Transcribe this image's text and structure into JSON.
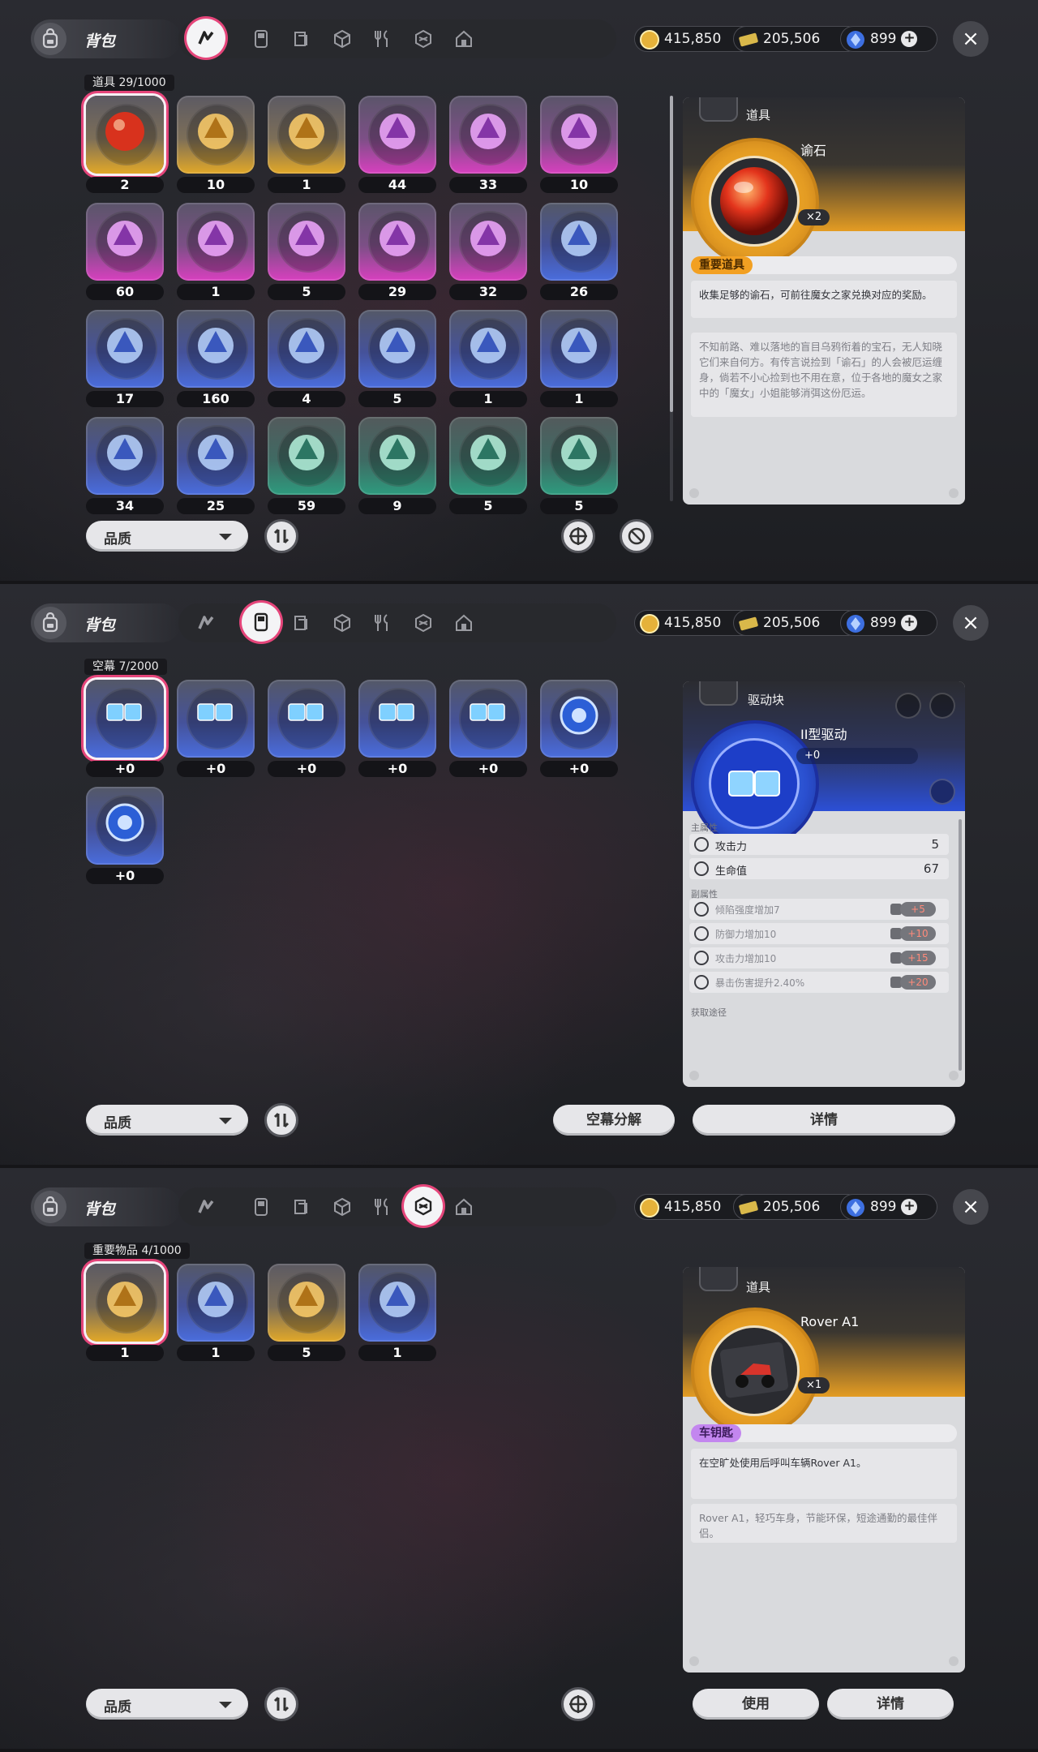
{
  "colors": {
    "accent": "#e5457a",
    "gold": "#e49c23",
    "purple": "#d840bf",
    "blue": "#4a6ddd",
    "green": "#2e9b7e"
  },
  "shared": {
    "bag_title": "背包",
    "currency": [
      {
        "icon": "gold-coin-icon",
        "value": "415,850"
      },
      {
        "icon": "ticket-icon",
        "value": "205,506"
      },
      {
        "icon": "crystal-icon",
        "value": "899"
      }
    ],
    "plus_label": "+",
    "close_label": "×",
    "quality_label": "品质"
  },
  "panels": {
    "items": {
      "active_tab": "tab-props",
      "count_label": "道具 29/1000",
      "grid": [
        {
          "q": "gold",
          "qty": "2",
          "icon": "red-orb-icon"
        },
        {
          "q": "gold",
          "qty": "10",
          "icon": "chess-knight-icon"
        },
        {
          "q": "gold",
          "qty": "1",
          "icon": "belt-icon"
        },
        {
          "q": "purple",
          "qty": "44",
          "icon": "cards-icon"
        },
        {
          "q": "purple",
          "qty": "33",
          "icon": "game-cartridge-icon"
        },
        {
          "q": "purple",
          "qty": "10",
          "icon": "crystal-cluster-icon"
        },
        {
          "q": "purple",
          "qty": "60",
          "icon": "ice-crystal-icon"
        },
        {
          "q": "purple",
          "qty": "1",
          "icon": "bottle-icon"
        },
        {
          "q": "purple",
          "qty": "5",
          "icon": "conch-icon"
        },
        {
          "q": "purple",
          "qty": "29",
          "icon": "sparkle-crystal-icon"
        },
        {
          "q": "purple",
          "qty": "32",
          "icon": "bunny-badge-icon"
        },
        {
          "q": "blue",
          "qty": "26",
          "icon": "document-icon"
        },
        {
          "q": "blue",
          "qty": "17",
          "icon": "mist-ring-icon"
        },
        {
          "q": "blue",
          "qty": "160",
          "icon": "coin-icon"
        },
        {
          "q": "blue",
          "qty": "4",
          "icon": "orb-pouch-icon"
        },
        {
          "q": "blue",
          "qty": "5",
          "icon": "snack-bag-icon"
        },
        {
          "q": "blue",
          "qty": "1",
          "icon": "paper-bag-icon"
        },
        {
          "q": "blue",
          "qty": "1",
          "icon": "chicken-icon"
        },
        {
          "q": "blue",
          "qty": "34",
          "icon": "paint-tube-icon"
        },
        {
          "q": "blue",
          "qty": "25",
          "icon": "bunny-medal-icon"
        },
        {
          "q": "green",
          "qty": "59",
          "icon": "magazine-icon"
        },
        {
          "q": "green",
          "qty": "9",
          "icon": "plate-icon"
        },
        {
          "q": "green",
          "qty": "5",
          "icon": "photo-icon"
        },
        {
          "q": "green",
          "qty": "5",
          "icon": "compass-icon"
        }
      ],
      "detail": {
        "category": "道具",
        "name": "谕石",
        "count": "×2",
        "tag": "重要道具",
        "desc": "收集足够的谕石，可前往魔女之家兑换对应的奖励。",
        "lore": "不知前路、难以落地的盲目乌鸦衔着的宝石，无人知晓它们来自何方。有传言说捡到「谕石」的人会被厄运缠身，倘若不小心捡到也不用在意，位于各地的魔女之家中的「魔女」小姐能够消弭这份厄运。"
      }
    },
    "drive": {
      "active_tab": "tab-drive",
      "count_label": "空幕 7/2000",
      "grid": [
        {
          "q": "blue",
          "qty": "+0",
          "icon": "drive-block-2-icon"
        },
        {
          "q": "blue",
          "qty": "+0",
          "icon": "drive-block-l-icon"
        },
        {
          "q": "blue",
          "qty": "+0",
          "icon": "drive-block-j-icon"
        },
        {
          "q": "blue",
          "qty": "+0",
          "icon": "drive-block-s-icon"
        },
        {
          "q": "blue",
          "qty": "+0",
          "icon": "drive-block-i-icon"
        },
        {
          "q": "blue",
          "qty": "+0",
          "icon": "drive-gear-icon"
        },
        {
          "q": "blue",
          "qty": "+0",
          "icon": "drive-bolt-icon"
        }
      ],
      "detail": {
        "category": "驱动块",
        "name": "II型驱动",
        "level": "+0",
        "main_label": "主属性",
        "main_stats": [
          {
            "icon": "attack-icon",
            "label": "攻击力",
            "value": "5"
          },
          {
            "icon": "heart-icon",
            "label": "生命值",
            "value": "67"
          }
        ],
        "sub_label": "副属性",
        "sub_stats": [
          {
            "icon": "smile-icon",
            "label": "倾陷强度增加7",
            "bonus": "+5"
          },
          {
            "icon": "shield-icon",
            "label": "防御力增加10",
            "bonus": "+10"
          },
          {
            "icon": "attack-icon",
            "label": "攻击力增加10",
            "bonus": "+15"
          },
          {
            "icon": "crit-icon",
            "label": "暴击伤害提升2.40%",
            "bonus": "+20"
          }
        ],
        "source_label": "获取途径"
      },
      "buttons": {
        "decompose": "空幕分解",
        "details": "详情"
      }
    },
    "key": {
      "active_tab": "tab-key-items",
      "count_label": "重要物品 4/1000",
      "grid": [
        {
          "q": "gold",
          "qty": "1",
          "icon": "scooter-card-icon"
        },
        {
          "q": "blue",
          "qty": "1",
          "icon": "dice-icon"
        },
        {
          "q": "gold",
          "qty": "5",
          "icon": "key-icon"
        },
        {
          "q": "blue",
          "qty": "1",
          "icon": "soap-icon"
        }
      ],
      "detail": {
        "category": "道具",
        "name": "Rover A1",
        "count": "×1",
        "tag": "车钥匙",
        "desc": "在空旷处使用后呼叫车辆Rover A1。",
        "lore": "Rover A1，轻巧车身，节能环保，短途通勤的最佳伴侣。"
      },
      "buttons": {
        "use": "使用",
        "details": "详情"
      }
    }
  }
}
